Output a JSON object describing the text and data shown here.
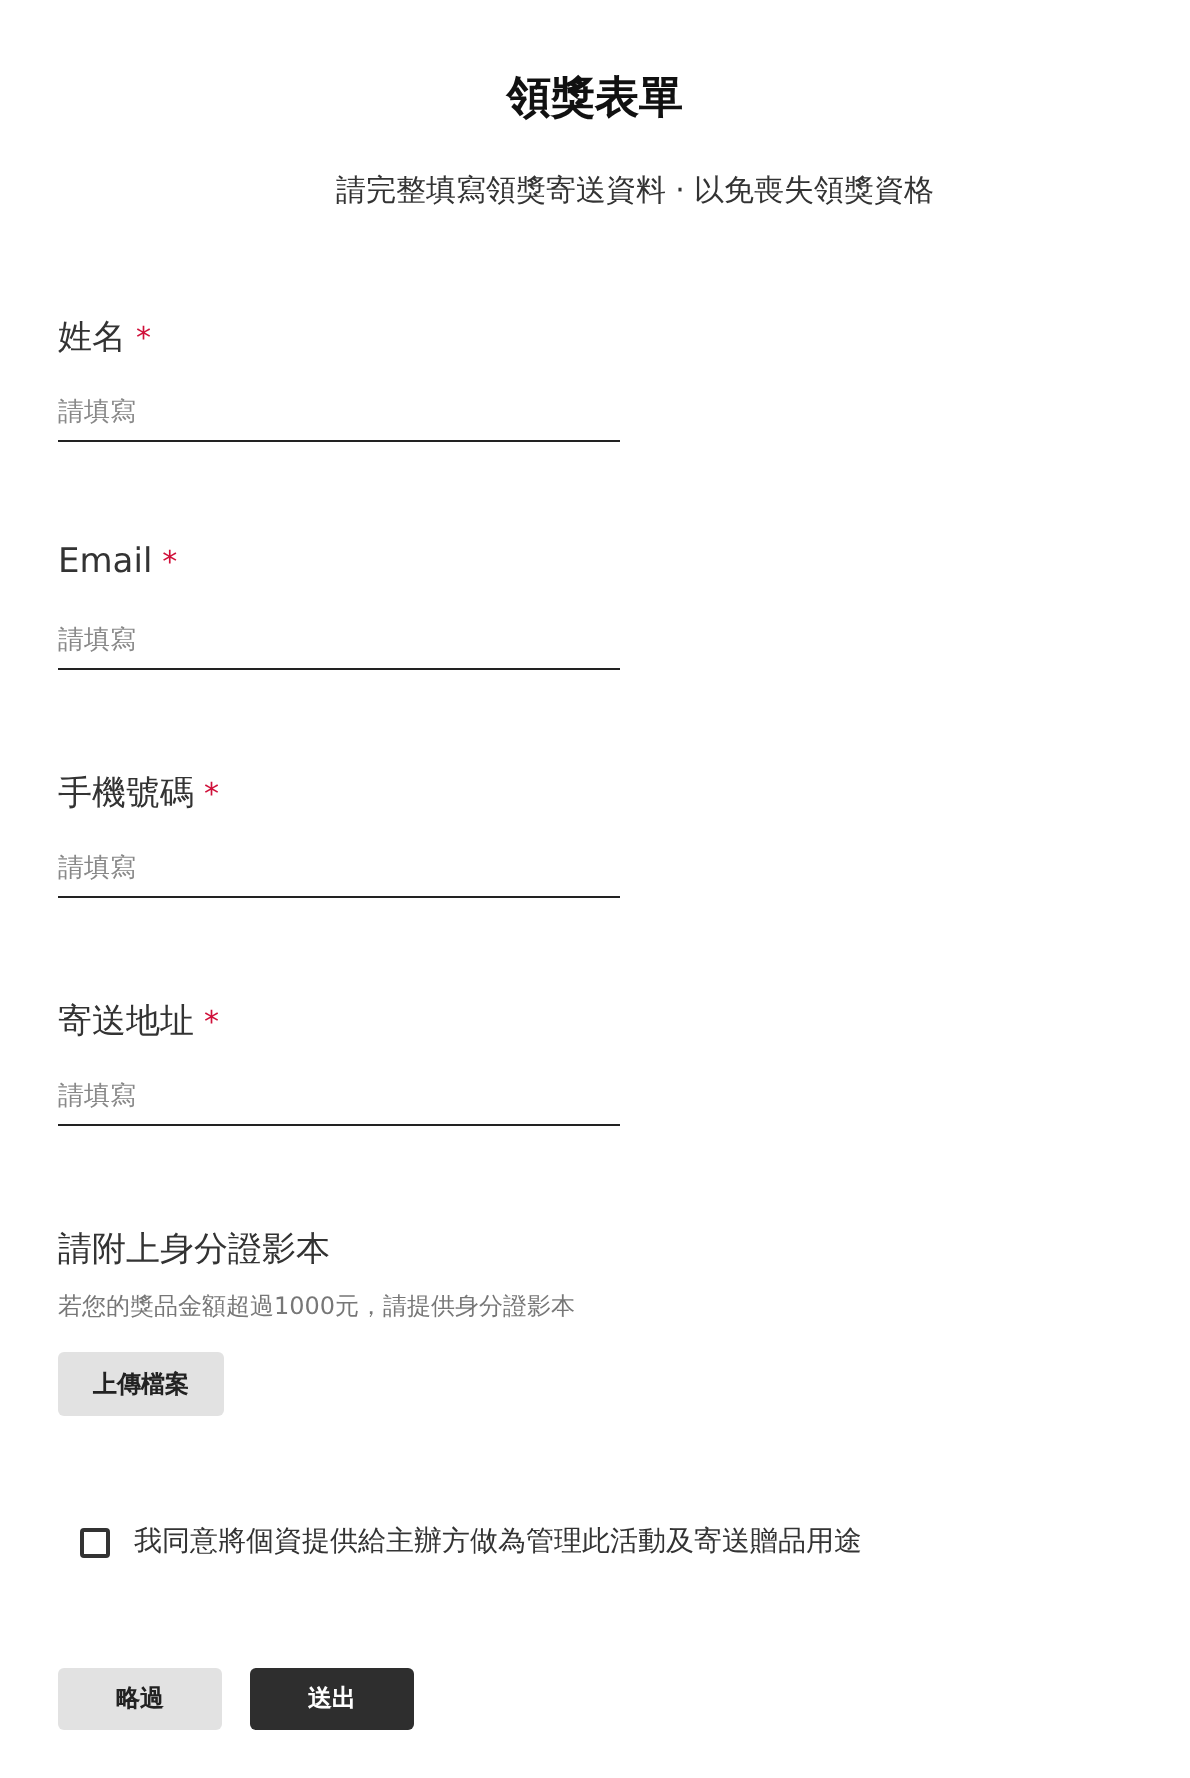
{
  "title": "領獎表單",
  "subtitle": "請完整填寫領獎寄送資料 · 以免喪失領獎資格",
  "fields": [
    {
      "label": "姓名",
      "required": true,
      "placeholder": "請填寫"
    },
    {
      "label": "Email",
      "required": true,
      "placeholder": "請填寫"
    },
    {
      "label": "手機號碼",
      "required": true,
      "placeholder": "請填寫"
    },
    {
      "label": "寄送地址",
      "required": true,
      "placeholder": "請填寫"
    }
  ],
  "required_mark": "*",
  "upload": {
    "label": "請附上身分證影本",
    "hint": "若您的獎品金額超過1000元，請提供身分證影本",
    "button": "上傳檔案"
  },
  "consent": {
    "label": "我同意將個資提供給主辦方做為管理此活動及寄送贈品用途",
    "checked": false
  },
  "buttons": [
    {
      "label": "略過",
      "kind": "secondary"
    },
    {
      "label": "送出",
      "kind": "primary"
    }
  ]
}
